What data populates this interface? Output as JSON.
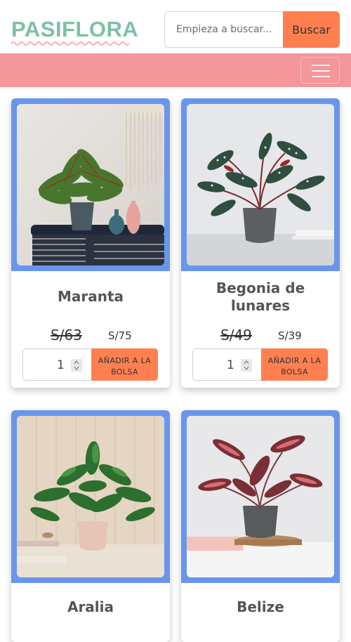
{
  "brand": {
    "name": "PASIFLORA",
    "color": "#7cc1a3"
  },
  "search": {
    "placeholder": "Empieza a buscar...",
    "button_label": "Buscar",
    "accent": "#ff7f50"
  },
  "navbar": {
    "color": "#f4979a",
    "menu_icon": "hamburger-menu-icon"
  },
  "products": [
    {
      "name": "Maranta",
      "old_price": "S/63",
      "new_price": "S/75",
      "quantity": "1",
      "add_label": "AÑADIR A LA BOLSA"
    },
    {
      "name": "Begonia de lunares",
      "old_price": "S/49",
      "new_price": "S/39",
      "quantity": "1",
      "add_label": "AÑADIR A LA BOLSA"
    },
    {
      "name": "Aralia"
    },
    {
      "name": "Belize"
    }
  ],
  "card_frame_color": "#6996ec"
}
